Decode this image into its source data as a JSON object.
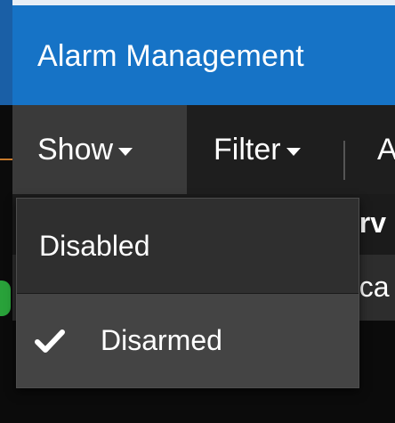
{
  "window": {
    "title": "Alarm Management"
  },
  "toolbar": {
    "show_label": "Show",
    "filter_label": "Filter",
    "more_label": "A"
  },
  "table": {
    "partial_header": "erv",
    "partial_cell": "oca"
  },
  "dropdown": {
    "items": [
      {
        "label": "Disabled",
        "checked": false
      },
      {
        "label": "Disarmed",
        "checked": true
      }
    ]
  },
  "colors": {
    "titlebar": "#1673c6",
    "toolbar": "#1e1e1e",
    "active_menu": "#3a3a3a",
    "dropdown_bg": "#2f2f2f",
    "selected_item": "#444444"
  },
  "icons": {
    "menu_caret": "caret-down-icon",
    "checked_item": "checkmark-icon"
  }
}
